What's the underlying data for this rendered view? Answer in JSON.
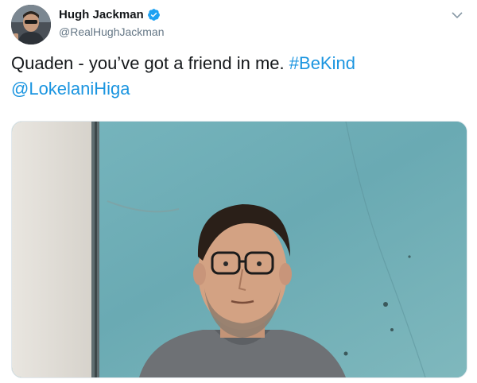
{
  "user": {
    "display_name": "Hugh Jackman",
    "handle": "@RealHughJackman",
    "verified": true,
    "avatar_icon": "profile-photo"
  },
  "tweet": {
    "text_main": "Quaden - you’ve got a friend in me.",
    "hashtag": "#BeKind",
    "mention": "@LokelaniHiga"
  },
  "media": {
    "type": "video-still",
    "description_icon": "photo"
  },
  "colors": {
    "link": "#1b95e0",
    "verified": "#1da1f2",
    "muted": "#657786",
    "wall": "#6fb0b9"
  }
}
